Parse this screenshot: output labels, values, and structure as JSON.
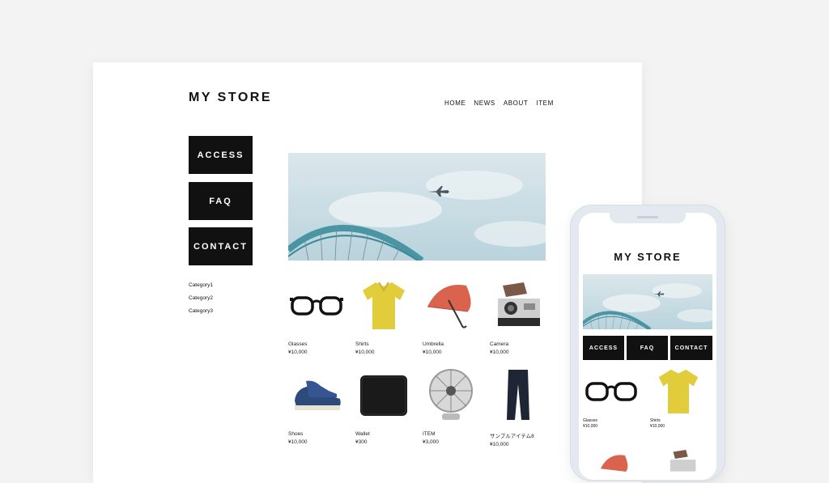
{
  "desktop": {
    "logo": "MY STORE",
    "nav": [
      "HOME",
      "NEWS",
      "ABOUT",
      "ITEM"
    ],
    "side_buttons": [
      "ACCESS",
      "FAQ",
      "CONTACT"
    ],
    "categories": [
      "Category1",
      "Category2",
      "Category3"
    ],
    "products": [
      {
        "name": "Glasses",
        "price": "¥10,000",
        "icon": "glasses-icon"
      },
      {
        "name": "Shirts",
        "price": "¥10,000",
        "icon": "shirt-icon"
      },
      {
        "name": "Umbrella",
        "price": "¥10,000",
        "icon": "umbrella-icon"
      },
      {
        "name": "Camera",
        "price": "¥10,000",
        "icon": "camera-icon"
      },
      {
        "name": "Shoes",
        "price": "¥10,000",
        "icon": "shoe-icon"
      },
      {
        "name": "Wallet",
        "price": "¥300",
        "icon": "wallet-icon"
      },
      {
        "name": "ITEM",
        "price": "¥3,000",
        "icon": "fan-icon"
      },
      {
        "name": "サンプルアイテム8",
        "price": "¥10,000",
        "icon": "pants-icon"
      }
    ]
  },
  "phone": {
    "logo": "MY STORE",
    "buttons": [
      "ACCESS",
      "FAQ",
      "CONTACT"
    ],
    "products": [
      {
        "name": "Glasses",
        "price": "¥10,000",
        "icon": "glasses-icon"
      },
      {
        "name": "Shirts",
        "price": "¥10,000",
        "icon": "shirt-icon"
      }
    ]
  },
  "colors": {
    "button_bg": "#111111",
    "page_bg": "#f3f3f3",
    "sky": "#c8dde4",
    "bridge": "#4a95a3"
  }
}
